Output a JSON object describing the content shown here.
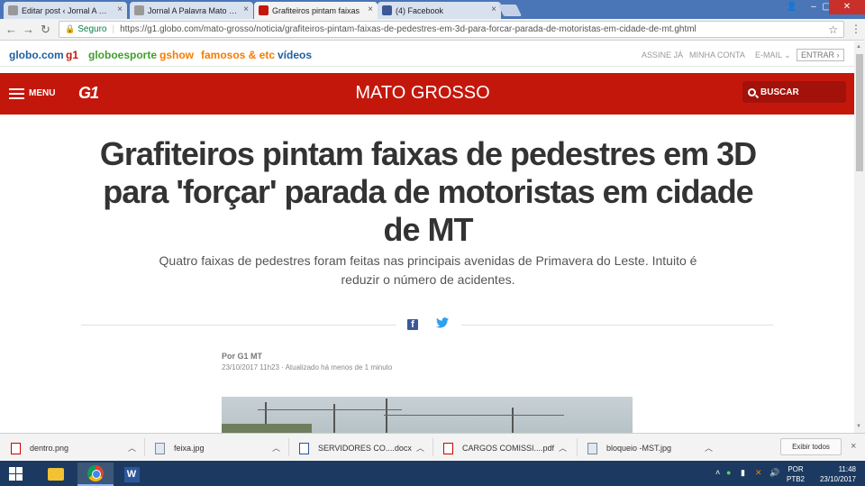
{
  "browser": {
    "tabs": [
      {
        "label": "Editar post ‹ Jornal A Pala",
        "favicon_color": "#999999",
        "active": false
      },
      {
        "label": "Jornal A Palavra Mato Gr",
        "favicon_color": "#999999",
        "active": false
      },
      {
        "label": "Grafiteiros pintam faixas",
        "favicon_color": "#c4170c",
        "active": true
      },
      {
        "label": "(4) Facebook",
        "favicon_color": "#3b5998",
        "active": false
      }
    ],
    "tab_close": "×",
    "security_label": "Seguro",
    "url": "https://g1.globo.com/mato-grosso/noticia/grafiteiros-pintam-faixas-de-pedestres-em-3d-para-forcar-parada-de-motoristas-em-cidade-de-mt.ghtml"
  },
  "globo_nav": {
    "links": [
      {
        "label": "globo.com",
        "color": "#1f5f9f"
      },
      {
        "label": "g1",
        "color": "#c4170c"
      },
      {
        "label": "globoesporte",
        "color": "#3f9f2a"
      },
      {
        "label": "gshow",
        "color": "#f57c00"
      },
      {
        "label": "famosos & etc",
        "color": "#f57c00"
      },
      {
        "label": "vídeos",
        "color": "#1f5f9f"
      }
    ],
    "account_links": [
      "ASSINE JÁ",
      "MINHA CONTA",
      "E-MAIL ⌄"
    ],
    "login": "ENTRAR ›"
  },
  "g1_header": {
    "menu_label": "MENU",
    "logo": "G1",
    "section": "MATO GROSSO",
    "search_label": "BUSCAR",
    "color": "#c4170c"
  },
  "article": {
    "title": "Grafiteiros pintam faixas de pedestres em 3D para 'forçar' parada de motoristas em cidade de MT",
    "subtitle": "Quatro faixas de pedestres foram feitas nas principais avenidas de Primavera do Leste. Intuito é reduzir o número de acidentes.",
    "share": {
      "facebook": "f",
      "twitter": "🐦"
    },
    "author": "Por G1 MT",
    "date": "23/10/2017 11h23 · Atualizado há menos de 1 minuto"
  },
  "downloads": {
    "items": [
      {
        "name": "dentro.png",
        "icon": "pdf-image-icon"
      },
      {
        "name": "feixa.jpg",
        "icon": "image-icon"
      },
      {
        "name": "SERVIDORES CO....docx",
        "icon": "word-doc-icon"
      },
      {
        "name": "CARGOS COMISSI....pdf",
        "icon": "pdf-icon"
      },
      {
        "name": "bloqueio -MST.jpg",
        "icon": "image-icon"
      }
    ],
    "show_all": "Exibir todos",
    "close": "×"
  },
  "taskbar": {
    "apps": [
      "file-explorer",
      "chrome",
      "word"
    ],
    "language": "POR",
    "layout": "PTB2",
    "time": "11:48",
    "date": "23/10/2017"
  }
}
